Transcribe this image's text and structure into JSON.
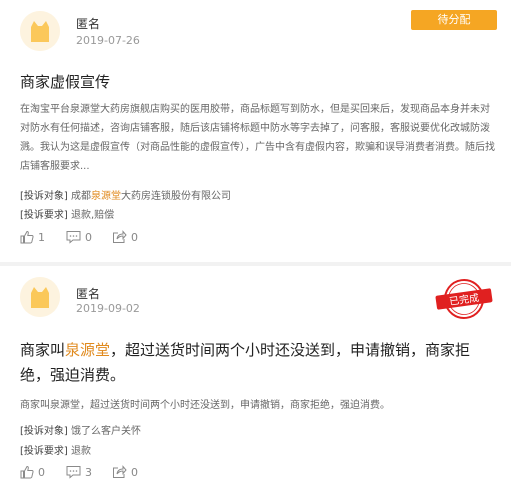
{
  "complaints": [
    {
      "author": "匿名",
      "date": "2019-07-26",
      "status": "待分配",
      "status_color": "#f5a623",
      "title": "商家虚假宣传",
      "description": "在淘宝平台泉源堂大药房旗舰店购买的医用胶带，商品标题写到防水，但是买回来后，发现商品本身并未对对防水有任何描述，咨询店铺客服，随后该店铺将标题中防水等字去掉了，问客服，客服说要优化改城防泼溅。我认为这是虚假宣传（对商品性能的虚假宣传），广告中含有虚假内容，欺骗和误导消费者消费。随后找店铺客服要求...",
      "target_label": "[投诉对象]",
      "target_prefix": "成都",
      "target_highlight": "泉源堂",
      "target_suffix": "大药房连锁股份有限公司",
      "request_label": "[投诉要求]",
      "request_value": "退款,赔偿",
      "likes": "1",
      "comments": "0",
      "shares": "0"
    },
    {
      "author": "匿名",
      "date": "2019-09-02",
      "status": "已完成",
      "status_color": "#e02020",
      "title_prefix": "商家叫",
      "title_highlight": "泉源堂",
      "title_suffix": "，超过送货时间两个小时还没送到，申请撤销，商家拒绝，强迫消费。",
      "description": "商家叫泉源堂，超过送货时间两个小时还没送到，申请撤销，商家拒绝，强迫消费。",
      "target_label": "[投诉对象]",
      "target_value": "饿了么客户关怀",
      "request_label": "[投诉要求]",
      "request_value": "退款",
      "likes": "0",
      "comments": "3",
      "shares": "0"
    }
  ],
  "icons": {
    "avatar": "cat-avatar-icon",
    "like": "thumbs-up-icon",
    "comment": "comment-icon",
    "share": "share-icon",
    "stamp": "completed-stamp-icon"
  }
}
